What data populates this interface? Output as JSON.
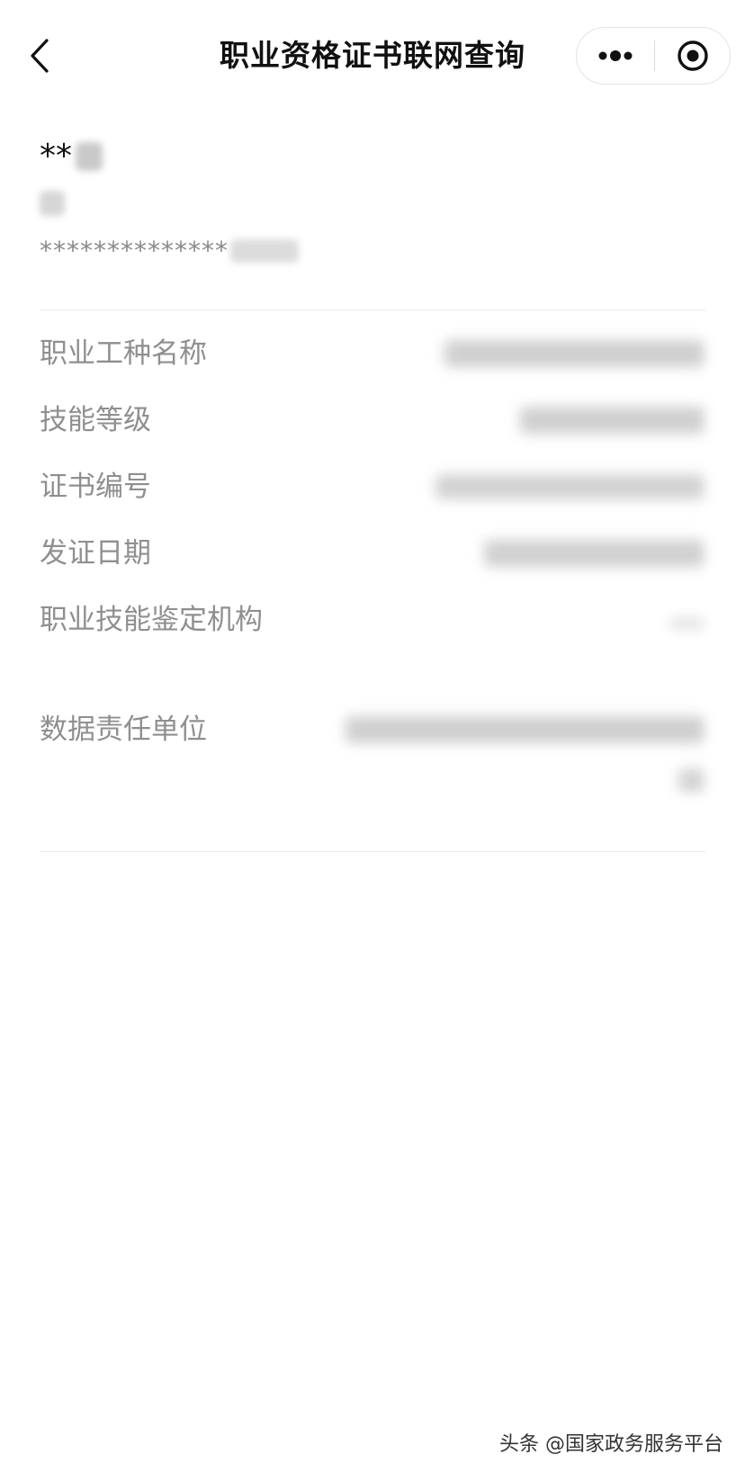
{
  "nav": {
    "title": "职业资格证书联网查询",
    "back_icon": "chevron-left-icon",
    "more_icon": "three-dots-icon",
    "close_icon": "target-circle-icon"
  },
  "holder": {
    "name_masked": "**",
    "id_masked": "**************"
  },
  "fields": [
    {
      "label": "职业工种名称",
      "value": ""
    },
    {
      "label": "技能等级",
      "value": ""
    },
    {
      "label": "证书编号",
      "value": ""
    },
    {
      "label": "发证日期",
      "value": ""
    },
    {
      "label": "职业技能鉴定机构",
      "value": ""
    },
    {
      "label": "数据责任单位",
      "value": ""
    }
  ],
  "watermark": "头条 @国家政务服务平台",
  "colors": {
    "label": "#8f8f8f",
    "text": "#111111",
    "divider": "#ececec"
  }
}
